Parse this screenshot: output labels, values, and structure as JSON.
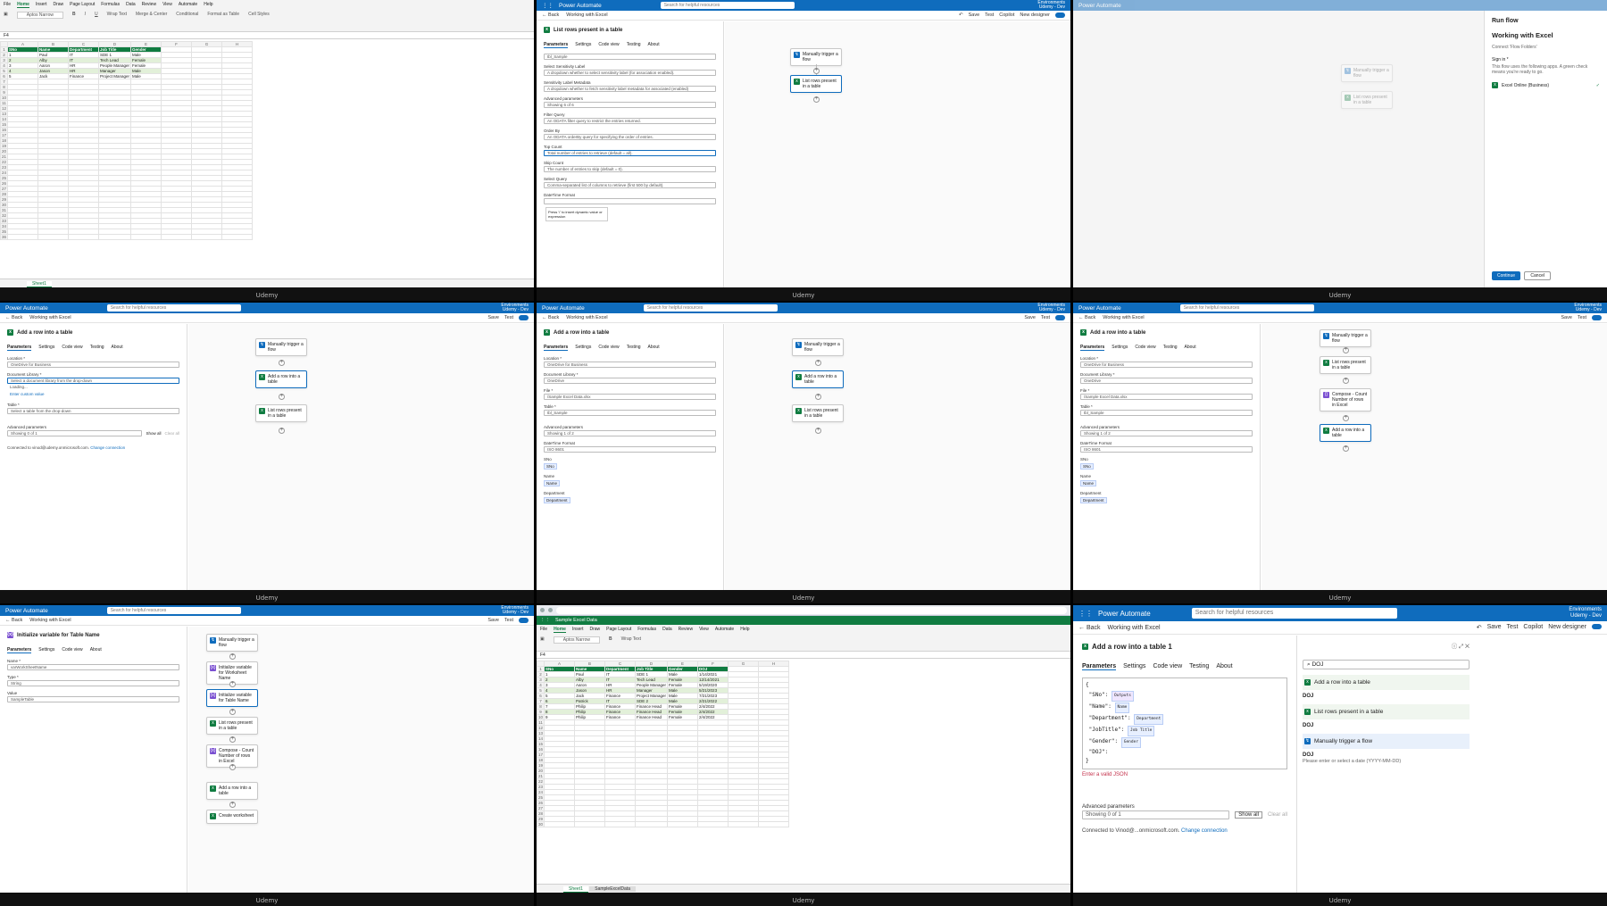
{
  "caption": "Udemy",
  "pa": {
    "app_title": "Power Automate",
    "search_placeholder": "Search for helpful resources",
    "env_label": "Environments",
    "env_name": "Udemy - Dev",
    "back": "Back",
    "flow_name": "Working with Excel",
    "save": "Save",
    "test": "Test",
    "copilot": "Copilot",
    "new_designer": "New designer",
    "tabs": [
      "Parameters",
      "Settings",
      "Code view",
      "Testing",
      "About"
    ]
  },
  "excel": {
    "menu": [
      "File",
      "Home",
      "Insert",
      "Draw",
      "Page Layout",
      "Formulas",
      "Data",
      "Review",
      "View",
      "Automate",
      "Help"
    ],
    "name_box": "F4",
    "columns": [
      "A",
      "B",
      "C",
      "D",
      "E",
      "F",
      "G",
      "H"
    ],
    "headers": [
      "SNo",
      "Name",
      "Department",
      "Job Title",
      "Gender",
      "DOJ"
    ],
    "rows_initial": [
      [
        "1",
        "Paul",
        "IT",
        "SDE 1",
        "Male"
      ],
      [
        "2",
        "Alby",
        "IT",
        "Tech Lead",
        "Female"
      ],
      [
        "3",
        "Aaron",
        "HR",
        "People Manager",
        "Female"
      ],
      [
        "4",
        "Jason",
        "HR",
        "Manager",
        "Male"
      ],
      [
        "5",
        "Jack",
        "Finance",
        "Project Manager",
        "Male"
      ]
    ],
    "rows_full": [
      [
        "1",
        "Paul",
        "IT",
        "SDE 1",
        "Male",
        "1/14/2021"
      ],
      [
        "2",
        "Alby",
        "IT",
        "Tech Lead",
        "Female",
        "12/14/2021"
      ],
      [
        "3",
        "Aaron",
        "HR",
        "People Manager",
        "Female",
        "5/19/2020"
      ],
      [
        "4",
        "Jason",
        "HR",
        "Manager",
        "Male",
        "5/21/2023"
      ],
      [
        "5",
        "Jack",
        "Finance",
        "Project Manager",
        "Male",
        "7/21/2023"
      ],
      [
        "6",
        "Patrick",
        "IT",
        "SDE 2",
        "Male",
        "2/21/2022"
      ],
      [
        "7",
        "Philip",
        "Finance",
        "Finance Head",
        "Female",
        "2/4/2022"
      ],
      [
        "8",
        "Philip",
        "Finance",
        "Finance Head",
        "Female",
        "2/4/2022"
      ],
      [
        "9",
        "Philip",
        "Finance",
        "Finance Head",
        "Female",
        "2/4/2022"
      ]
    ],
    "sheet_tab": "Sheet1",
    "sheet_tab2": "SampleExcelData",
    "book_title": "Sample Excel Data"
  },
  "p1": {
    "caption": "Udemy"
  },
  "p2": {
    "panel_title": "List rows present in a table",
    "fields": [
      {
        "label": "",
        "value": "tbl_Sample"
      },
      {
        "label": "Select Sensitivity Label",
        "value": "A dropdown whether to select sensitivity label (for association enabled)."
      },
      {
        "label": "Sensitivity Label Metadata",
        "value": "A dropdown whether to fetch sensitivity label metadata for associated (enabled)"
      },
      {
        "label": "Advanced parameters",
        "value": "Showing 6 of 6"
      },
      {
        "label": "Filter Query",
        "value": "An ODATA filter query to restrict the entries returned."
      },
      {
        "label": "Order By",
        "value": "An ODATA orderBy query for specifying the order of entries."
      },
      {
        "label": "Top Count",
        "value": "Total number of entries to retrieve (default = all)."
      },
      {
        "label": "Skip Count",
        "value": "The number of entries to skip (default = 0)."
      },
      {
        "label": "Select Query",
        "value": "Comma-separated list of columns to retrieve (first 500 by default)."
      },
      {
        "label": "DateTime Format",
        "value": ""
      }
    ],
    "tooltip": "Press '/' to insert dynamic value or expression",
    "nodes": [
      "Manually trigger a flow",
      "List rows present in a table"
    ]
  },
  "p3": {
    "run_title": "Run flow",
    "flow_name": "Working with Excel",
    "connections_label": "Connect 'Flow Folders'",
    "signin": "Sign in *",
    "signin_desc": "This flow uses the following apps. A green check means you're ready to go.",
    "app": "Excel Online (Business)",
    "continue": "Continue",
    "cancel": "Cancel"
  },
  "p4": {
    "panel_title": "Add a row into a table",
    "location_label": "Location *",
    "location": "OneDrive for Business",
    "doclib_label": "Document Library *",
    "doclib": "Select a document library from the drop-down",
    "loading": "Loading...",
    "custom": "Enter custom value",
    "table_label": "Table *",
    "table": "Select a table from the drop-down",
    "adv_label": "Advanced parameters",
    "adv": "Showing 0 of 1",
    "showall": "Show all",
    "clearall": "Clear all",
    "connected": "Connected to vinod@udemy.onmicrosoft.com.",
    "change": "Change connection",
    "nodes": [
      "Manually trigger a flow",
      "Add a row into a table",
      "List rows present in a table"
    ]
  },
  "p5": {
    "panel_title": "Add a row into a table",
    "location": "OneDrive for Business",
    "doclib": "OneDrive",
    "file_label": "File *",
    "file": "/Sample Excel Data.xlsx",
    "table": "tbl_Sample",
    "adv": "Showing 1 of 2",
    "datefmt_label": "DateTime Format",
    "datefmt": "ISO 8601",
    "sno_label": "SNo",
    "sno": "SNo",
    "name_label": "Name",
    "name": "Name",
    "dept_label": "Department",
    "dept": "Department",
    "nodes": [
      "Manually trigger a flow",
      "Add a row into a table",
      "List rows present in a table"
    ]
  },
  "p6": {
    "panel_title": "Add a row into a table",
    "nodes": [
      "Manually trigger a flow",
      "List rows present in a table",
      "Compose - Count Number of rows in Excel",
      "Add a row into a table"
    ]
  },
  "p7": {
    "panel_title": "Initialize variable for Table Name",
    "name_label": "Name *",
    "name": "varWorkSheetName",
    "type_label": "Type *",
    "type": "String",
    "value_label": "Value",
    "value": "SampleTable",
    "nodes": [
      "Manually trigger a flow",
      "Initialize variable for Worksheet Name",
      "Initialize variable for Table Name",
      "List rows present in a table",
      "Compose - Count Number of rows in Excel",
      "Add a row into a table",
      "Create worksheet"
    ]
  },
  "p9": {
    "panel_title": "Add a row into a table 1",
    "json_lines": [
      "{",
      "\"SNo\":",
      "\"Name\":",
      "\"Department\":",
      "\"JobTitle\":",
      "\"Gender\":",
      "\"DOJ\":",
      "}"
    ],
    "chips": [
      "Outputs",
      "Name",
      "Department",
      "Job Title",
      "Gender"
    ],
    "error": "Enter a valid JSON",
    "adv_label": "Advanced parameters",
    "adv": "Showing 0 of 1",
    "showall": "Show all",
    "clearall": "Clear all",
    "connected": "Connected to Vinod@...onmicrosoft.com.",
    "change": "Change connection",
    "search_value": "DOJ",
    "groups": [
      {
        "title": "Add a row into a table",
        "label": "DOJ"
      },
      {
        "title": "List rows present in a table",
        "label": "DOJ"
      },
      {
        "title": "Manually trigger a flow",
        "label": "DOJ",
        "desc": "Please enter or select a date (YYYY-MM-DD)"
      }
    ]
  }
}
